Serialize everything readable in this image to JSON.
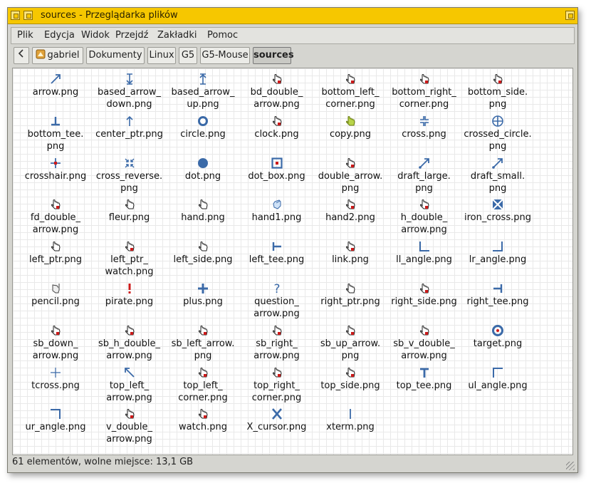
{
  "window": {
    "title": "sources - Przeglądarka plików",
    "accent": "#f6c700"
  },
  "menu": [
    {
      "label": "Plik"
    },
    {
      "label": "Edycja"
    },
    {
      "label": "Widok"
    },
    {
      "label": "Przejdź"
    },
    {
      "label": "Zakładki"
    },
    {
      "label": "Pomoc"
    }
  ],
  "pathbar": {
    "back_icon": "chevron-left-icon",
    "crumbs": [
      {
        "label": "gabriel",
        "icon": "home-icon"
      },
      {
        "label": "Dokumenty"
      },
      {
        "label": "Linux"
      },
      {
        "label": "G5"
      },
      {
        "label": "G5-Mouse"
      },
      {
        "label": "sources",
        "active": true
      }
    ]
  },
  "files": [
    {
      "name": "arrow.png",
      "icon": "arrow"
    },
    {
      "name": "based_arrow_\ndown.png",
      "icon": "based-arrow-down"
    },
    {
      "name": "based_arrow_\nup.png",
      "icon": "based-arrow-up"
    },
    {
      "name": "bd_double_\narrow.png",
      "icon": "hand-cursor"
    },
    {
      "name": "bottom_left_\ncorner.png",
      "icon": "hand-cursor"
    },
    {
      "name": "bottom_right_\ncorner.png",
      "icon": "hand-cursor"
    },
    {
      "name": "bottom_side.\npng",
      "icon": "hand-cursor"
    },
    {
      "name": "bottom_tee.\npng",
      "icon": "bottom-tee"
    },
    {
      "name": "center_ptr.png",
      "icon": "center-ptr"
    },
    {
      "name": "circle.png",
      "icon": "circle"
    },
    {
      "name": "clock.png",
      "icon": "hand-cursor"
    },
    {
      "name": "copy.png",
      "icon": "copy-hand"
    },
    {
      "name": "cross.png",
      "icon": "cross"
    },
    {
      "name": "crossed_circle.\npng",
      "icon": "crossed-circle"
    },
    {
      "name": "crosshair.png",
      "icon": "crosshair"
    },
    {
      "name": "cross_reverse.\npng",
      "icon": "cross-reverse"
    },
    {
      "name": "dot.png",
      "icon": "dot"
    },
    {
      "name": "dot_box.png",
      "icon": "dot-box"
    },
    {
      "name": "double_arrow.\npng",
      "icon": "hand-cursor"
    },
    {
      "name": "draft_large.\npng",
      "icon": "draft"
    },
    {
      "name": "draft_small.\npng",
      "icon": "draft"
    },
    {
      "name": "fd_double_\narrow.png",
      "icon": "hand-cursor"
    },
    {
      "name": "fleur.png",
      "icon": "hand-outline"
    },
    {
      "name": "hand.png",
      "icon": "hand-outline"
    },
    {
      "name": "hand1.png",
      "icon": "hand-blue"
    },
    {
      "name": "hand2.png",
      "icon": "hand-cursor"
    },
    {
      "name": "h_double_\narrow.png",
      "icon": "hand-cursor"
    },
    {
      "name": "iron_cross.png",
      "icon": "iron-cross"
    },
    {
      "name": "left_ptr.png",
      "icon": "hand-outline"
    },
    {
      "name": "left_ptr_\nwatch.png",
      "icon": "hand-cursor"
    },
    {
      "name": "left_side.png",
      "icon": "hand-outline"
    },
    {
      "name": "left_tee.png",
      "icon": "left-tee"
    },
    {
      "name": "link.png",
      "icon": "hand-cursor"
    },
    {
      "name": "ll_angle.png",
      "icon": "ll-angle"
    },
    {
      "name": "lr_angle.png",
      "icon": "lr-angle"
    },
    {
      "name": "pencil.png",
      "icon": "pencil-hand"
    },
    {
      "name": "pirate.png",
      "icon": "pirate"
    },
    {
      "name": "plus.png",
      "icon": "plus"
    },
    {
      "name": "question_\narrow.png",
      "icon": "question"
    },
    {
      "name": "right_ptr.png",
      "icon": "hand-outline"
    },
    {
      "name": "right_side.png",
      "icon": "hand-cursor"
    },
    {
      "name": "right_tee.png",
      "icon": "right-tee"
    },
    {
      "name": "sb_down_\narrow.png",
      "icon": "hand-cursor"
    },
    {
      "name": "sb_h_double_\narrow.png",
      "icon": "hand-cursor"
    },
    {
      "name": "sb_left_arrow.\npng",
      "icon": "hand-cursor"
    },
    {
      "name": "sb_right_\narrow.png",
      "icon": "hand-cursor"
    },
    {
      "name": "sb_up_arrow.\npng",
      "icon": "hand-cursor"
    },
    {
      "name": "sb_v_double_\narrow.png",
      "icon": "hand-cursor"
    },
    {
      "name": "target.png",
      "icon": "target"
    },
    {
      "name": "tcross.png",
      "icon": "tcross"
    },
    {
      "name": "top_left_\narrow.png",
      "icon": "top-left-arrow"
    },
    {
      "name": "top_left_\ncorner.png",
      "icon": "hand-cursor"
    },
    {
      "name": "top_right_\ncorner.png",
      "icon": "hand-cursor"
    },
    {
      "name": "top_side.png",
      "icon": "hand-cursor"
    },
    {
      "name": "top_tee.png",
      "icon": "top-tee"
    },
    {
      "name": "ul_angle.png",
      "icon": "ul-angle"
    },
    {
      "name": "ur_angle.png",
      "icon": "ur-angle"
    },
    {
      "name": "v_double_\narrow.png",
      "icon": "hand-cursor"
    },
    {
      "name": "watch.png",
      "icon": "hand-cursor"
    },
    {
      "name": "X_cursor.png",
      "icon": "x-cursor"
    },
    {
      "name": "xterm.png",
      "icon": "xterm"
    }
  ],
  "status": {
    "text": "61 elementów, wolne miejsce: 13,1 GB"
  },
  "colors": {
    "icon_blue": "#3b6aa8",
    "icon_red": "#cc1a1a"
  }
}
